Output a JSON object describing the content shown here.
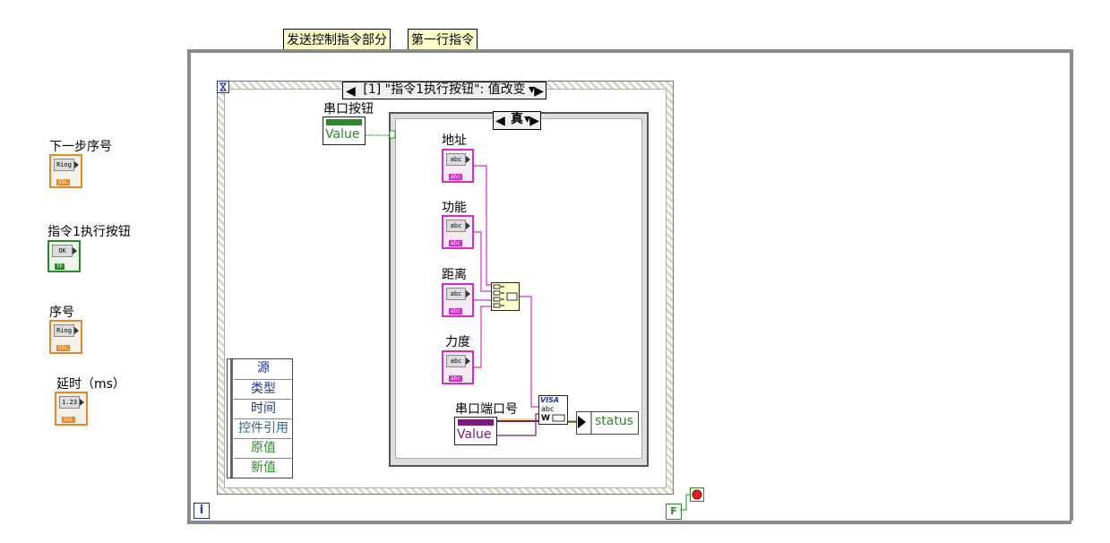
{
  "notes": {
    "send_section": "发送控制指令部分",
    "first_row": "第一行指令"
  },
  "controls": [
    {
      "label": "下一步序号",
      "kind": "ring",
      "inner": "Ring",
      "type": "SGL"
    },
    {
      "label": "指令1执行按钮",
      "kind": "bool",
      "inner": "OK",
      "type": "TF"
    },
    {
      "label": "序号",
      "kind": "ring",
      "inner": "Ring",
      "type": "SGL"
    },
    {
      "label": "延时（ms）",
      "kind": "numeric",
      "inner": "1.23",
      "type": "SGL"
    }
  ],
  "event_structure": {
    "selector_text": "[1] \"指令1执行按钮\": 值改变",
    "data_node": [
      "源",
      "类型",
      "时间",
      "控件引用",
      "原值",
      "新值"
    ]
  },
  "serial_button": {
    "label": "串口按钮",
    "property": "Value"
  },
  "case_structure": {
    "selector_text": "真"
  },
  "string_controls": [
    {
      "label": "地址",
      "inner": "abc",
      "type": "abc"
    },
    {
      "label": "功能",
      "inner": "abc",
      "type": "abc"
    },
    {
      "label": "距离",
      "inner": "abc",
      "type": "abc"
    },
    {
      "label": "力度",
      "inner": "abc",
      "type": "abc"
    }
  ],
  "serial_port": {
    "label": "串口端口号",
    "property": "Value"
  },
  "visa_write": {
    "top": "VISA",
    "middle": "abc",
    "bottom": "W"
  },
  "status_indicator": "status",
  "loop": {
    "iteration": "i",
    "stop_value": "F"
  },
  "colors": {
    "string_wire": "#d12ec8",
    "bool_wire": "#2a8a2a",
    "ring": "#e08a2a",
    "loop_frame": "#8a8a8a"
  }
}
